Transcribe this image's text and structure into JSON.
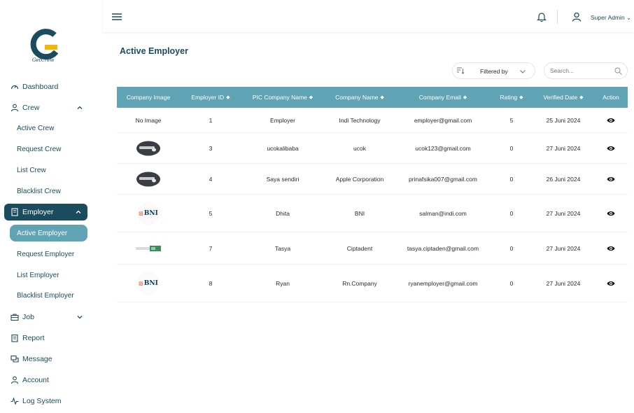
{
  "brand": {
    "name": "GetCrew"
  },
  "topbar": {
    "user_name": "Super Admin",
    "user_chevron": "⌄"
  },
  "sidebar": {
    "dashboard": "Dashboard",
    "crew": "Crew",
    "crew_sub": [
      "Active Crew",
      "Request Crew",
      "List Crew",
      "Blacklist Crew"
    ],
    "employer": "Employer",
    "employer_sub": [
      "Active Employer",
      "Request Employer",
      "List Employer",
      "Blacklist Employer"
    ],
    "job": "Job",
    "report": "Report",
    "message": "Message",
    "account": "Account",
    "log_system": "Log System"
  },
  "page": {
    "title": "Active Employer"
  },
  "filter": {
    "label": "Filtered by"
  },
  "search": {
    "placeholder": "Search..."
  },
  "table": {
    "columns": [
      "Company Image",
      "Employer ID",
      "PIC Company Name",
      "Company Name",
      "Company Email",
      "Rating",
      "Verified Date",
      "Action"
    ],
    "rows": [
      {
        "image": "none",
        "image_text": "No Image",
        "employer_id": "1",
        "pic_name": "Employer",
        "company_name": "Indi Technology",
        "email": "employer@gmail.com",
        "rating": "5",
        "verified_date": "25 Juni 2024"
      },
      {
        "image": "laptop",
        "employer_id": "3",
        "pic_name": "ucokalibaba",
        "company_name": "ucok",
        "email": "ucok123@gmail.com",
        "rating": "0",
        "verified_date": "27 Juni 2024"
      },
      {
        "image": "laptop",
        "employer_id": "4",
        "pic_name": "Saya sendiri",
        "company_name": "Apple Corporation",
        "email": "prinafsika007@gmail.com",
        "rating": "0",
        "verified_date": "26 Juni 2024"
      },
      {
        "image": "bni",
        "image_text": "BNI",
        "employer_id": "5",
        "pic_name": "Dhita",
        "company_name": "BNI",
        "email": "salman@indi.com",
        "rating": "0",
        "verified_date": "27 Juni 2024"
      },
      {
        "image": "card",
        "employer_id": "7",
        "pic_name": "Tasya",
        "company_name": "Ciptadent",
        "email": "tasya.ciptaden@gmail.com",
        "rating": "0",
        "verified_date": "27 Juni 2024"
      },
      {
        "image": "bni",
        "image_text": "BNI",
        "employer_id": "8",
        "pic_name": "Ryan",
        "company_name": "Rn.Company",
        "email": "ryanemployer@gmail.com",
        "rating": "0",
        "verified_date": "27 Juni 2024"
      }
    ]
  },
  "colors": {
    "primary": "#1b4c5e",
    "accent": "#5fa3b4",
    "logo_yellow": "#f2b705"
  },
  "icons": [
    "menu-icon",
    "bell-icon",
    "user-icon",
    "dashboard-icon",
    "crew-icon",
    "employer-icon",
    "job-icon",
    "report-icon",
    "message-icon",
    "account-icon",
    "log-icon",
    "filter-icon",
    "search-icon",
    "eye-icon",
    "chevron-down-icon",
    "chevron-up-icon"
  ]
}
